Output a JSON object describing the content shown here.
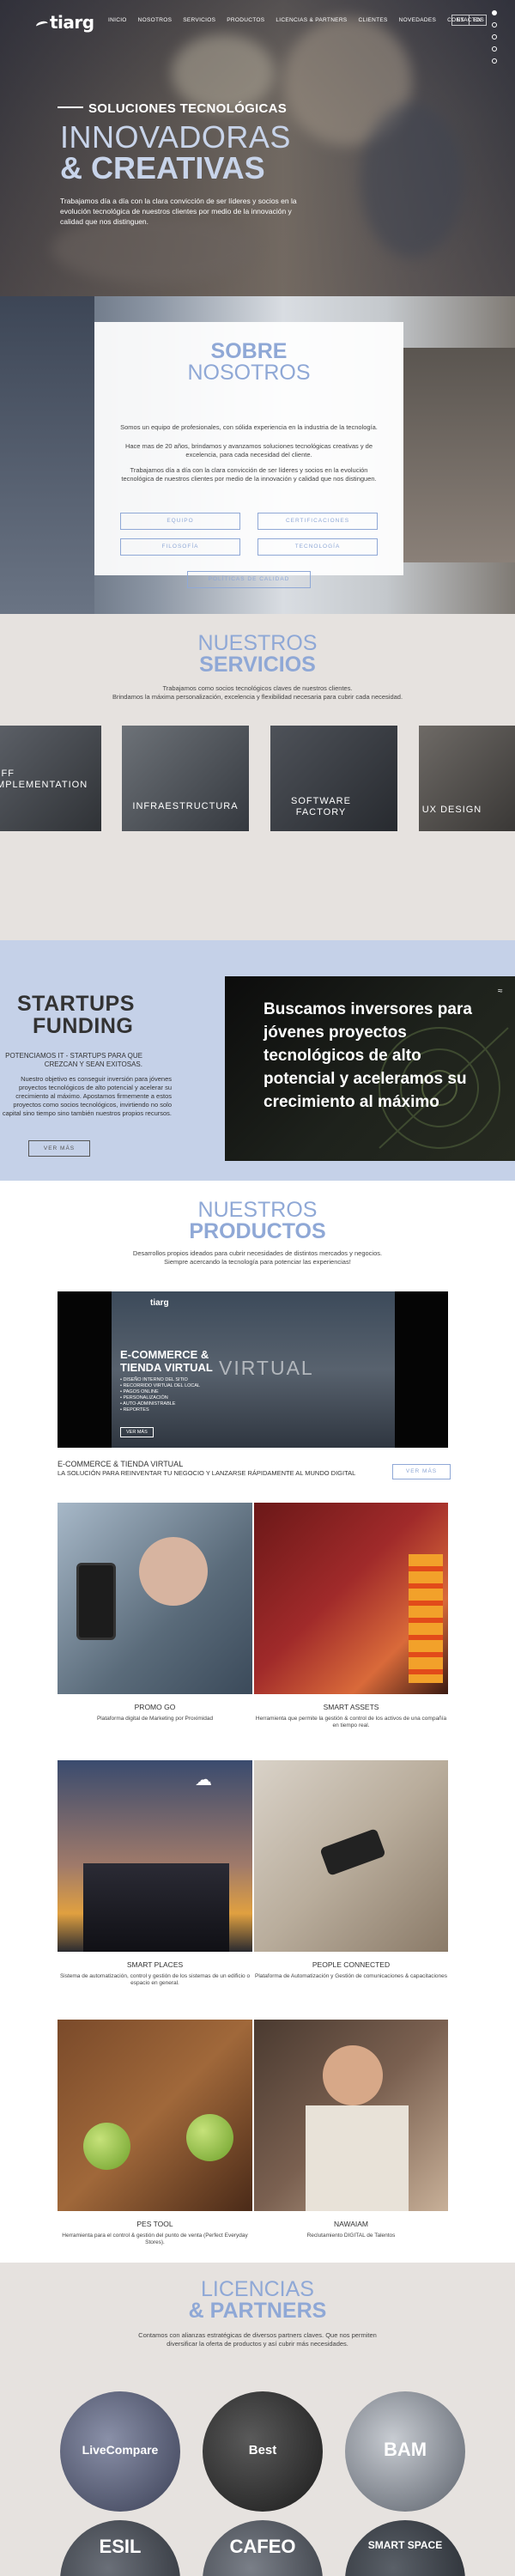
{
  "brand": {
    "logo_text": "tiarg"
  },
  "nav": {
    "items": [
      "INICIO",
      "NOSOTROS",
      "SERVICIOS",
      "PRODUCTOS",
      "LICENCIAS & PARTNERS",
      "CLIENTES",
      "NOVEDADES",
      "CONTACTOS"
    ],
    "languages": [
      "ES",
      "EN"
    ]
  },
  "hero": {
    "kicker": "SOLUCIONES TECNOLÓGICAS",
    "title_line1": "INNOVADORAS",
    "title_line2": "& CREATIVAS",
    "paragraph": "Trabajamos día a día con la clara convicción de ser líderes y socios en la evolución tecnológica de nuestros clientes por medio de la innovación y calidad que nos distinguen."
  },
  "about": {
    "title_line1": "SOBRE",
    "title_line2": "NOSOTROS",
    "p1": "Somos un equipo de profesionales, con sólida experiencia en la industria de la tecnología.",
    "p2": "Hace mas de 20 años, brindamos y avanzamos soluciones tecnológicas creativas y de excelencia, para cada necesidad del cliente.",
    "p3": "Trabajamos día a día con la clara convicción de ser líderes y socios en la evolución tecnológica de nuestros clientes por medio de la innovación y calidad que nos distinguen.",
    "buttons": [
      "EQUIPO",
      "CERTIFICACIONES",
      "FILOSOFÍA",
      "TECNOLOGÍA",
      "POLÍTICAS DE CALIDAD"
    ]
  },
  "services": {
    "title_line1": "NUESTROS",
    "title_line2": "SERVICIOS",
    "p1": "Trabajamos como socios tecnológicos claves de nuestros clientes.",
    "p2": "Brindamos la máxima personalización, excelencia y flexibilidad necesaria para cubrir cada necesidad.",
    "tiles": [
      "OFF\nIMPLEMENTATION",
      "INFRAESTRUCTURA",
      "SOFTWARE\nFACTORY",
      "UX DESIGN"
    ]
  },
  "startups": {
    "title_line1": "STARTUPS",
    "title_line2": "FUNDING",
    "subtitle": "POTENCIAMOS IT - STARTUPS PARA QUE CREZCAN Y SEAN EXITOSAS.",
    "paragraph": "Nuestro objetivo es conseguir inversión para jóvenes proyectos tecnológicos de alto potencial y acelerar su crecimiento al máximo. Apostamos firmemente a estos proyectos como socios tecnológicos, invirtiendo no solo capital sino tiempo sino también nuestros propios recursos.",
    "button": "VER MÁS",
    "panel_text": "Buscamos inversores para jóvenes proyectos tecnológicos de alto potencial y aceleramos su crecimiento al máximo"
  },
  "products": {
    "title_line1": "NUESTROS",
    "title_line2": "PRODUCTOS",
    "p1": "Desarrollos propios ideados para cubrir necesidades de distintos mercados y negocios.",
    "p2": "Siempre acercando la tecnología para potenciar las experiencias!",
    "video": {
      "title_line1": "E-COMMERCE &",
      "title_line2": "TIENDA VIRTUAL",
      "watermark": "VIRTUAL",
      "bullets": [
        "• DISEÑO INTERNO DEL SITIO",
        "• RECORRIDO VIRTUAL DEL LOCAL",
        "• PAGOS ONLINE",
        "• PERSONALIZACIÓN",
        "• AUTO-ADMINISTRABLE",
        "• REPORTES"
      ],
      "button": "VER MÁS"
    },
    "featured_title": "E-COMMERCE & TIENDA VIRTUAL",
    "featured_subtitle": "LA SOLUCIÓN PARA REINVENTAR TU NEGOCIO Y LANZARSE RÁPIDAMENTE AL MUNDO DIGITAL",
    "featured_button": "VER MÁS",
    "items": [
      {
        "name": "PROMO GO",
        "desc": "Plataforma digital de Marketing por Proximidad"
      },
      {
        "name": "SMART ASSETS",
        "desc": "Herramienta que permite la gestión & control de los activos de una compañía en tiempo real."
      },
      {
        "name": "SMART PLACES",
        "desc": "Sistema de automatización, control y gestión de los sistemas de un edificio o espacio en general."
      },
      {
        "name": "PEOPLE CONNECTED",
        "desc": "Plataforma de Automatización y Gestión de comunicaciones & capacitaciones"
      },
      {
        "name": "PES TOOL",
        "desc": "Herramienta para el control & gestión del punto de venta (Perfect Everyday Stores)."
      },
      {
        "name": "NAWAIAM",
        "desc": "Reclutamiento DIGITAL de Talentos"
      }
    ]
  },
  "licenses": {
    "title_line1": "LICENCIAS",
    "title_line2": "& PARTNERS",
    "p1": "Contamos con alianzas estratégicas de diversos partners claves. Que nos permiten",
    "p2": "diversificar la oferta de productos y así cubrir más necesidades.",
    "partners": [
      "LiveCompare",
      "Best",
      "BAM",
      "ESIL",
      "CAFEO",
      "SMART SPACE"
    ]
  },
  "colors": {
    "accent": "#8fa8d6",
    "startup_bg": "#c5d1e8",
    "section_bg": "#e6e2df"
  }
}
